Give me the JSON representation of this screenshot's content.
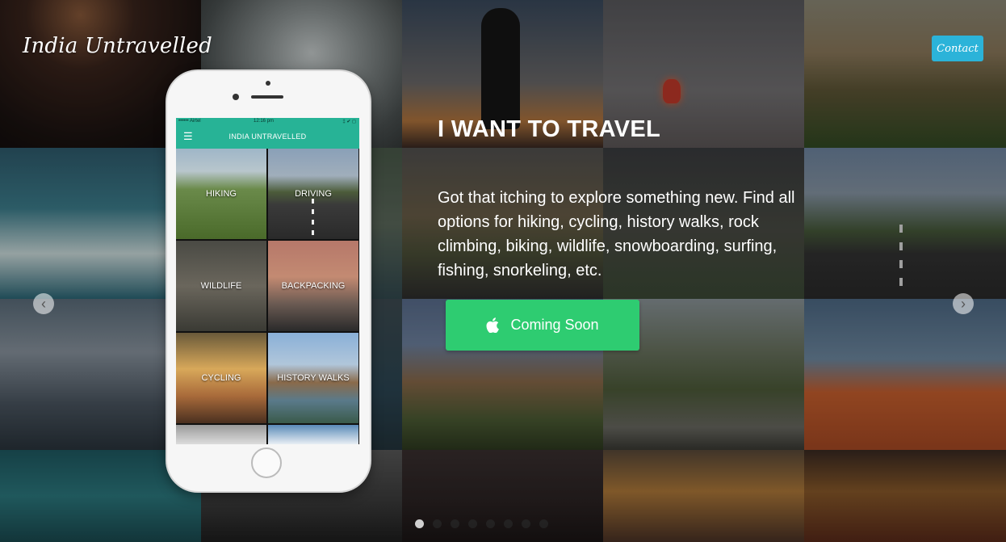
{
  "brand": {
    "name": "India Untravelled"
  },
  "nav": {
    "contact_label": "Contact"
  },
  "hero": {
    "title": "I WANT TO TRAVEL",
    "description": "Got that itching to explore something new. Find all options for hiking, cycling, history walks, rock climbing, biking, wildlife, snowboarding, surfing, fishing, snorkeling, etc.",
    "cta_label": "Coming Soon",
    "cta_icon": "apple-icon"
  },
  "carousel": {
    "prev_icon": "chevron-left-icon",
    "next_icon": "chevron-right-icon",
    "dot_count": 8,
    "active_dot": 0
  },
  "phone": {
    "status": {
      "carrier": "•••••• Airtel",
      "time": "12:16 pm",
      "battery": "‡ ✔ ◻"
    },
    "app_title": "INDIA UNTRAVELLED",
    "menu_icon": "hamburger-icon",
    "categories": [
      {
        "label": "HIKING"
      },
      {
        "label": "DRIVING"
      },
      {
        "label": "WILDLIFE"
      },
      {
        "label": "BACKPACKING"
      },
      {
        "label": "CYCLING"
      },
      {
        "label": "HISTORY WALKS"
      }
    ]
  },
  "colors": {
    "accent_teal": "#27b396",
    "contact_blue": "#2bb3d9",
    "cta_green": "#2ecc71"
  }
}
